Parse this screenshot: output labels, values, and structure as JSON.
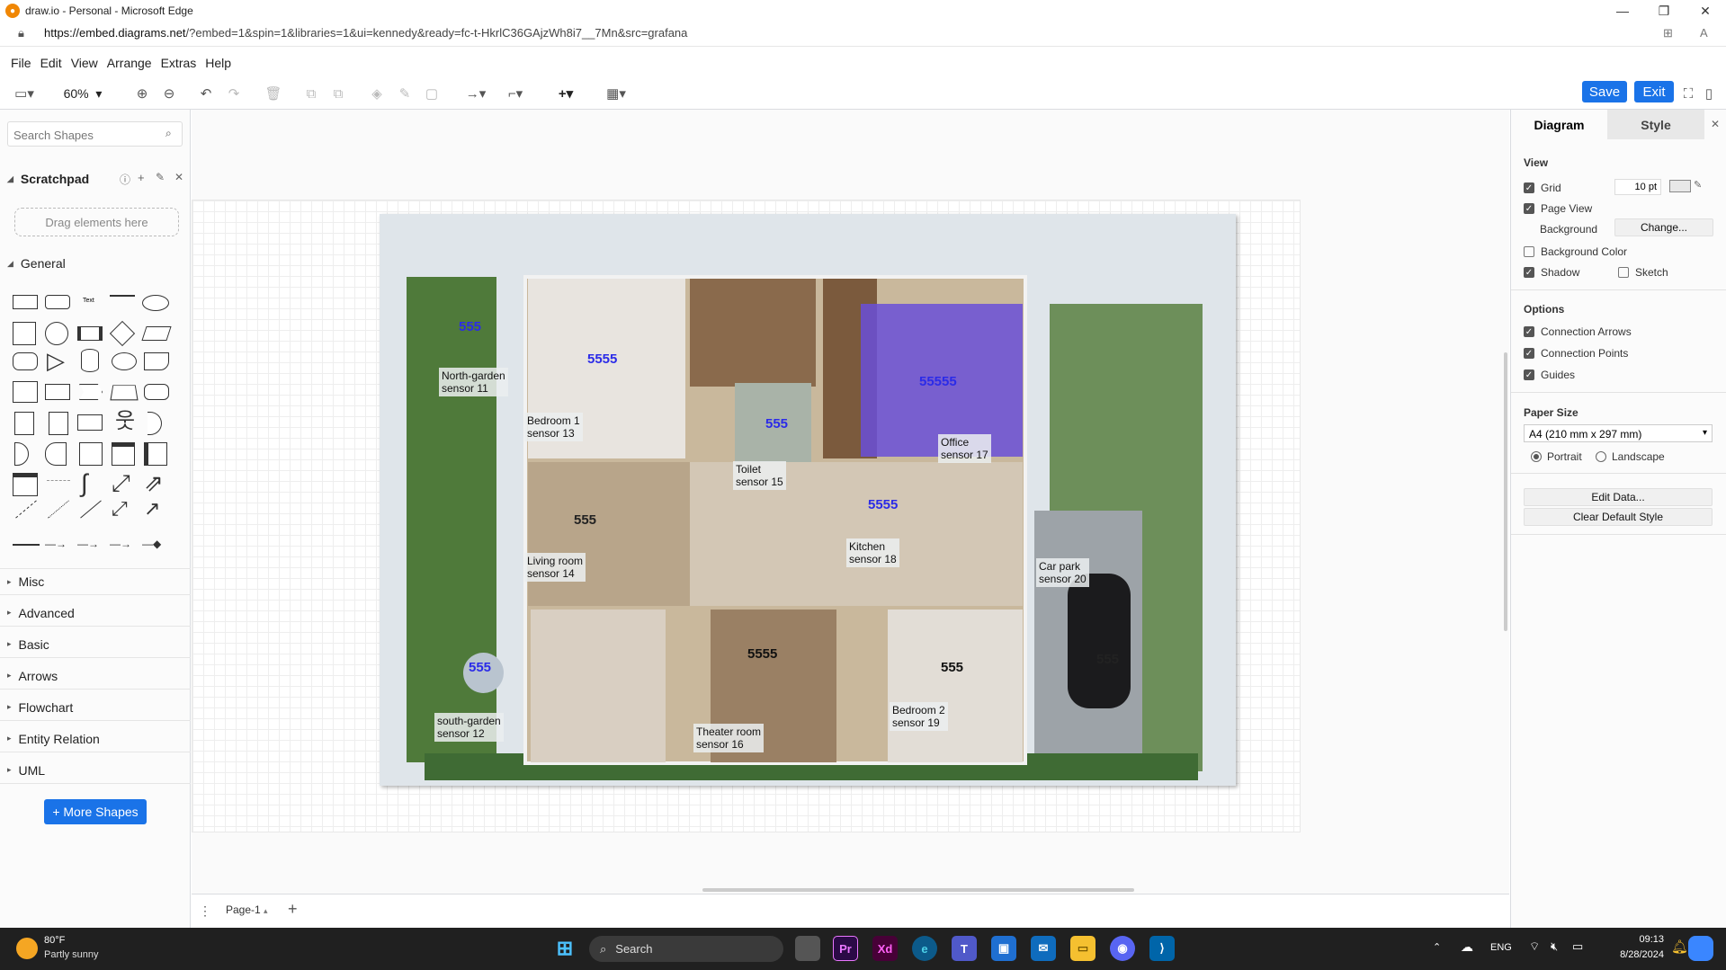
{
  "browser": {
    "title": "draw.io - Personal - Microsoft Edge",
    "url_domain": "https://embed.diagrams.net",
    "url_rest": "/?embed=1&spin=1&libraries=1&ui=kennedy&ready=fc-t-HkrlC36GAjzWh8i7__7Mn&src=grafana"
  },
  "menu": [
    "File",
    "Edit",
    "View",
    "Arrange",
    "Extras",
    "Help"
  ],
  "toolbar": {
    "zoom": "60%",
    "save": "Save",
    "exit": "Exit"
  },
  "left": {
    "search_placeholder": "Search Shapes",
    "scratchpad": "Scratchpad",
    "drag_hint": "Drag elements here",
    "general": "General",
    "sections": [
      "Misc",
      "Advanced",
      "Basic",
      "Arrows",
      "Flowchart",
      "Entity Relation",
      "UML"
    ],
    "more_shapes": "+ More Shapes"
  },
  "plan": {
    "rooms": [
      {
        "label1": "North-garden",
        "label2": "sensor 11",
        "value": "555"
      },
      {
        "label1": "Bedroom 1",
        "label2": "sensor 13",
        "value": "5555"
      },
      {
        "label1": "Toilet",
        "label2": "sensor 15",
        "value": "555"
      },
      {
        "label1": "Office",
        "label2": "sensor 17",
        "value": "55555"
      },
      {
        "label1": "Living room",
        "label2": "sensor 14",
        "value": "555"
      },
      {
        "label1": "Kitchen",
        "label2": "sensor 18",
        "value": "5555"
      },
      {
        "label1": "Car park",
        "label2": "sensor 20",
        "value": "555"
      },
      {
        "label1": "south-garden",
        "label2": "sensor 12",
        "value": "555"
      },
      {
        "label1": "Theater room",
        "label2": "sensor 16",
        "value": "5555"
      },
      {
        "label1": "Bedroom 2",
        "label2": "sensor 19",
        "value": "555"
      }
    ]
  },
  "pages": {
    "current": "Page-1"
  },
  "right": {
    "tab_diagram": "Diagram",
    "tab_style": "Style",
    "view": "View",
    "grid": "Grid",
    "grid_size": "10 pt",
    "page_view": "Page View",
    "background": "Background",
    "change": "Change...",
    "background_color": "Background Color",
    "shadow": "Shadow",
    "sketch": "Sketch",
    "options": "Options",
    "connection_arrows": "Connection Arrows",
    "connection_points": "Connection Points",
    "guides": "Guides",
    "paper_size": "Paper Size",
    "paper_value": "A4 (210 mm x 297 mm)",
    "portrait": "Portrait",
    "landscape": "Landscape",
    "edit_data": "Edit Data...",
    "clear_style": "Clear Default Style"
  },
  "taskbar": {
    "temp": "80°F",
    "weather": "Partly sunny",
    "search": "Search",
    "lang": "ENG",
    "time": "09:13",
    "date": "8/28/2024"
  }
}
